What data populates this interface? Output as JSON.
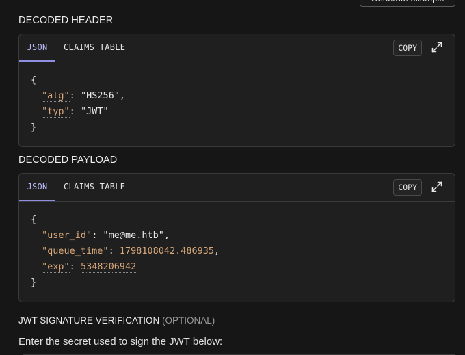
{
  "top_button": {
    "label": "Generate example"
  },
  "header_section": {
    "title": "DECODED HEADER",
    "tabs": {
      "json": "JSON",
      "claims": "CLAIMS TABLE"
    },
    "copy_label": "COPY",
    "open_brace": "{",
    "close_brace": "}",
    "lines": [
      {
        "key": "alg",
        "value": "\"HS256\"",
        "type": "string",
        "comma": ","
      },
      {
        "key": "typ",
        "value": "\"JWT\"",
        "type": "string",
        "comma": ""
      }
    ]
  },
  "payload_section": {
    "title": "DECODED PAYLOAD",
    "tabs": {
      "json": "JSON",
      "claims": "CLAIMS TABLE"
    },
    "copy_label": "COPY",
    "open_brace": "{",
    "close_brace": "}",
    "lines": [
      {
        "key": "user_id",
        "value": "\"me@me.htb\"",
        "type": "string",
        "comma": ","
      },
      {
        "key": "queue_time",
        "value": "1798108042.486935",
        "type": "number",
        "comma": ","
      },
      {
        "key": "exp",
        "value": "5348206942",
        "type": "number",
        "comma": ""
      }
    ]
  },
  "verification": {
    "title": "JWT SIGNATURE VERIFICATION",
    "optional": "(OPTIONAL)",
    "hint": "Enter the secret used to sign the JWT below:"
  },
  "icons": {
    "expand": "expand-icon"
  },
  "colors": {
    "background": "#161616",
    "panel": "#1f1f1f",
    "accent_tab": "#8e8fe0",
    "key": "#d9a87a",
    "number": "#d9a87a"
  }
}
